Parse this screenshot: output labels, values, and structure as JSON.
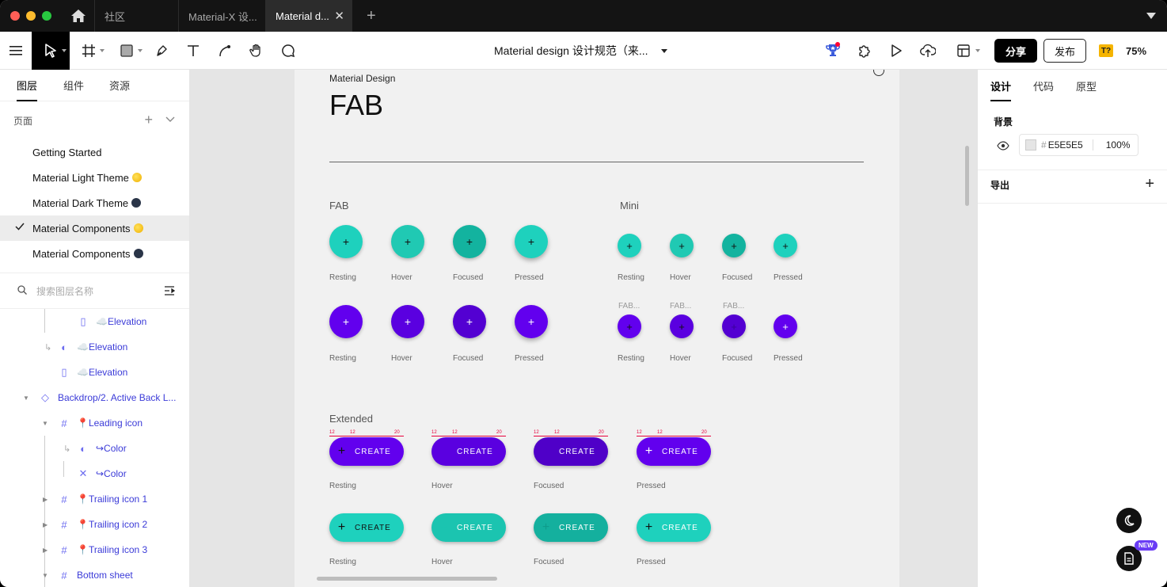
{
  "tabs": {
    "community": "社区",
    "tab1": "Material-X 设...",
    "tab2": "Material d..."
  },
  "toolbar": {
    "doc_title": "Material design 设计规范（来...",
    "share": "分享",
    "publish": "发布",
    "font_badge": "T?",
    "zoom": "75%"
  },
  "left_panel": {
    "tabs": [
      "图层",
      "组件",
      "资源"
    ],
    "pages_label": "页面",
    "pages": [
      {
        "name": "Getting Started",
        "emoji": ""
      },
      {
        "name": "Material Light Theme",
        "emoji": "sun"
      },
      {
        "name": "Material Dark Theme",
        "emoji": "moon"
      },
      {
        "name": "Material Components",
        "emoji": "sun",
        "active": true
      },
      {
        "name": "Material Components",
        "emoji": "moon"
      }
    ],
    "search_placeholder": "搜索图层名称",
    "layers": [
      {
        "name": "☁️Elevation",
        "icon": "rect-icon"
      },
      {
        "name": "☁️Elevation",
        "icon": "half-circle-icon"
      },
      {
        "name": "☁️Elevation",
        "icon": "rect-icon"
      },
      {
        "name": "Backdrop/2. Active Back L...",
        "icon": "component-icon"
      },
      {
        "name": "📍Leading icon",
        "icon": "frame-icon"
      },
      {
        "name": "↪Color",
        "icon": "half-circle-icon"
      },
      {
        "name": "↪Color",
        "icon": "cross-icon"
      },
      {
        "name": "📍Trailing icon 1",
        "icon": "frame-icon"
      },
      {
        "name": "📍Trailing icon 2",
        "icon": "frame-icon"
      },
      {
        "name": "📍Trailing icon 3",
        "icon": "frame-icon"
      },
      {
        "name": "Bottom sheet",
        "icon": "frame-icon"
      }
    ]
  },
  "canvas": {
    "subtitle": "Material Design",
    "title": "FAB",
    "fab_label": "FAB",
    "mini_label": "Mini",
    "extended_label": "Extended",
    "states": [
      "Resting",
      "Hover",
      "Focused",
      "Pressed"
    ],
    "mini_layer_label": "FAB...",
    "create_label": "CREATE",
    "spec_numbers": [
      "12",
      "12",
      "20"
    ],
    "colors": {
      "teal": "#1ed1bd",
      "purple": "#6200ee"
    }
  },
  "right_panel": {
    "tabs": [
      "设计",
      "代码",
      "原型"
    ],
    "background_label": "背景",
    "bg_hex": "E5E5E5",
    "bg_opacity": "100%",
    "export_label": "导出",
    "new_badge": "NEW"
  }
}
